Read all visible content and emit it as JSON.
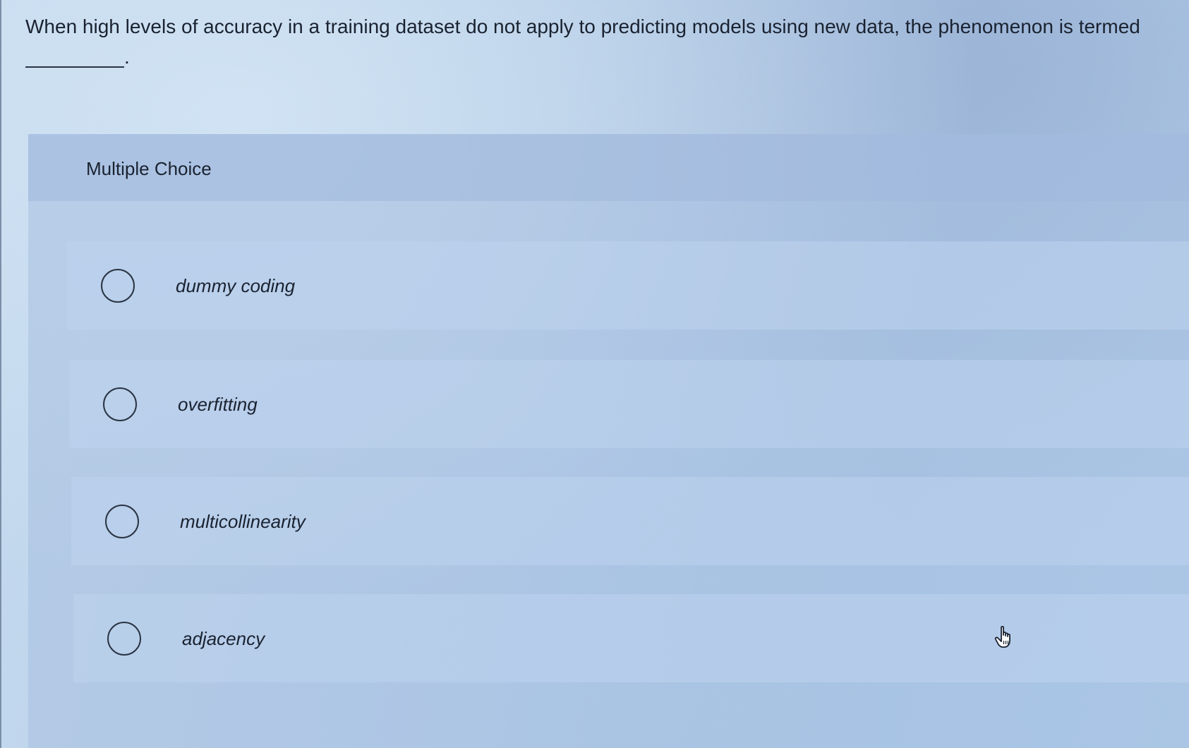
{
  "question": {
    "text": "When high levels of accuracy in a training dataset do not apply to predicting models using new data, the phenomenon is termed",
    "blank_suffix": "."
  },
  "multiple_choice": {
    "title": "Multiple Choice",
    "options": [
      {
        "label": "dummy coding",
        "selected": false
      },
      {
        "label": "overfitting",
        "selected": false
      },
      {
        "label": "multicollinearity",
        "selected": false
      },
      {
        "label": "adjacency",
        "selected": false
      }
    ]
  },
  "icons": {
    "radio": "radio-unchecked-icon",
    "cursor": "hand-pointer-icon"
  },
  "colors": {
    "text": "#1a2230",
    "background": "#b7cfe8"
  }
}
